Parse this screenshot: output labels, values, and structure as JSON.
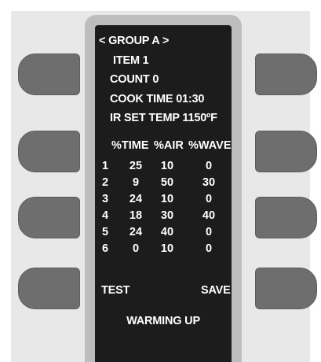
{
  "screen": {
    "group_line": "< GROUP  A >",
    "item_line": "ITEM 1",
    "count_line": "COUNT  0",
    "cook_time_line": "COOK TIME  01:30",
    "ir_set_temp_line": "IR SET TEMP  1150ºF"
  },
  "table": {
    "headers": [
      "%TIME",
      "%AIR",
      "%WAVE"
    ],
    "rows": [
      [
        "1",
        "25",
        "10",
        "0"
      ],
      [
        "2",
        "9",
        "50",
        "30"
      ],
      [
        "3",
        "24",
        "10",
        "0"
      ],
      [
        "4",
        "18",
        "30",
        "40"
      ],
      [
        "5",
        "24",
        "40",
        "0"
      ],
      [
        "6",
        "0",
        "10",
        "0"
      ]
    ]
  },
  "softkey_labels": {
    "test": "TEST",
    "save": "SAVE"
  },
  "status": "WARMING UP",
  "colors": {
    "screen_bg": "#1c1c1c",
    "bezel": "#bdbdbd",
    "panel": "#e8e8e8",
    "softkey": "#6e6e6e",
    "text": "#ffffff"
  }
}
